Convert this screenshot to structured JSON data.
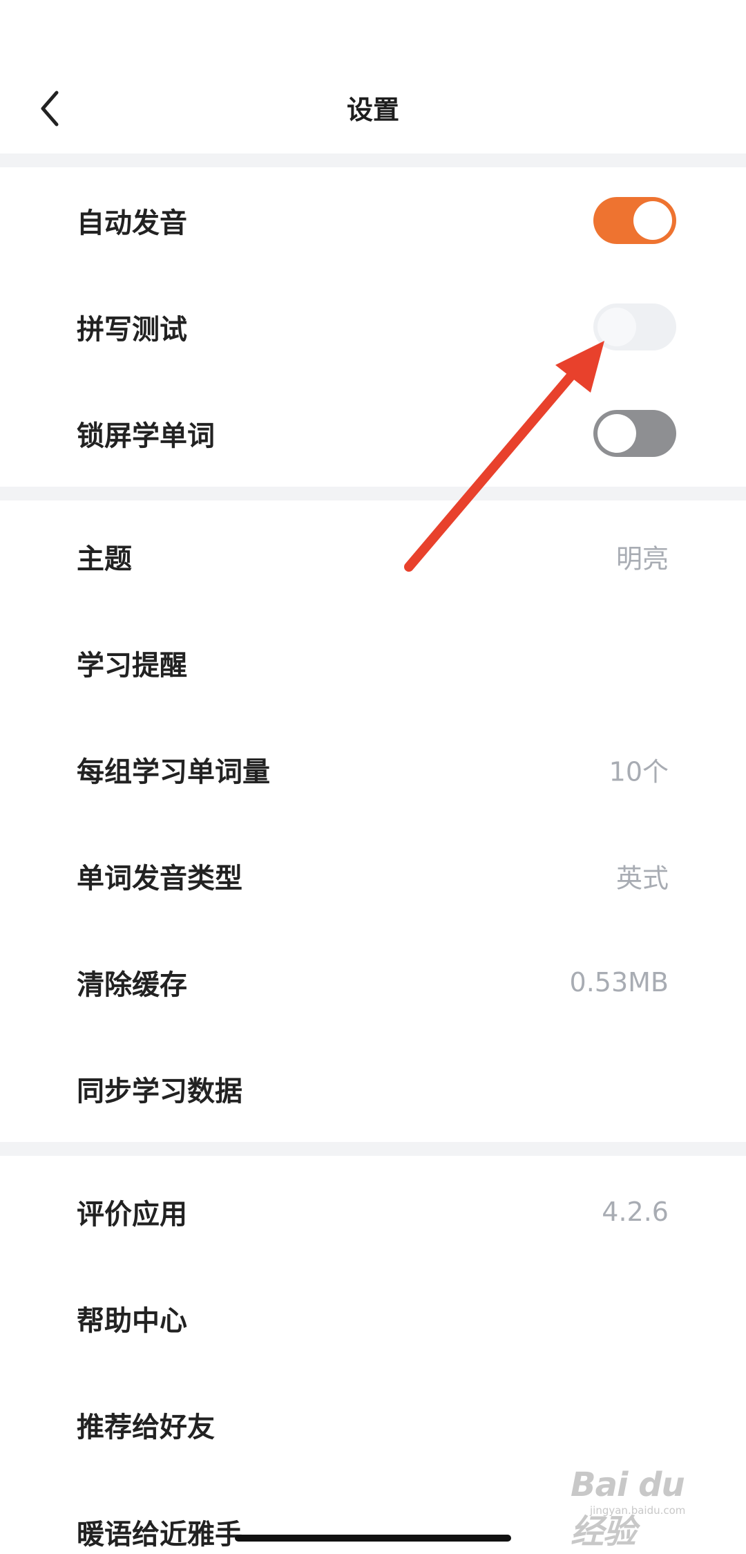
{
  "header": {
    "title": "设置",
    "back_icon": "chevron-left-icon"
  },
  "section1": [
    {
      "label": "自动发音",
      "toggle": "on"
    },
    {
      "label": "拼写测试",
      "toggle": "off"
    },
    {
      "label": "锁屏学单词",
      "toggle": "off"
    }
  ],
  "section2": [
    {
      "label": "主题",
      "value": "明亮"
    },
    {
      "label": "学习提醒",
      "value": ""
    },
    {
      "label": "每组学习单词量",
      "value": "10个"
    },
    {
      "label": "单词发音类型",
      "value": "英式"
    },
    {
      "label": "清除缓存",
      "value": "0.53MB"
    },
    {
      "label": "同步学习数据",
      "value": ""
    }
  ],
  "section3": [
    {
      "label": "评价应用",
      "value": "4.2.6"
    },
    {
      "label": "帮助中心",
      "value": ""
    },
    {
      "label": "推荐给好友",
      "value": ""
    },
    {
      "label": "暖语给近雅手",
      "value": ""
    }
  ],
  "watermark": {
    "logo": "Bai du 经验",
    "sub": "jingyan.baidu.com"
  },
  "colors": {
    "accent": "#ee7330",
    "annotation_arrow": "#e8412c",
    "value_gray": "#a8acb3"
  }
}
